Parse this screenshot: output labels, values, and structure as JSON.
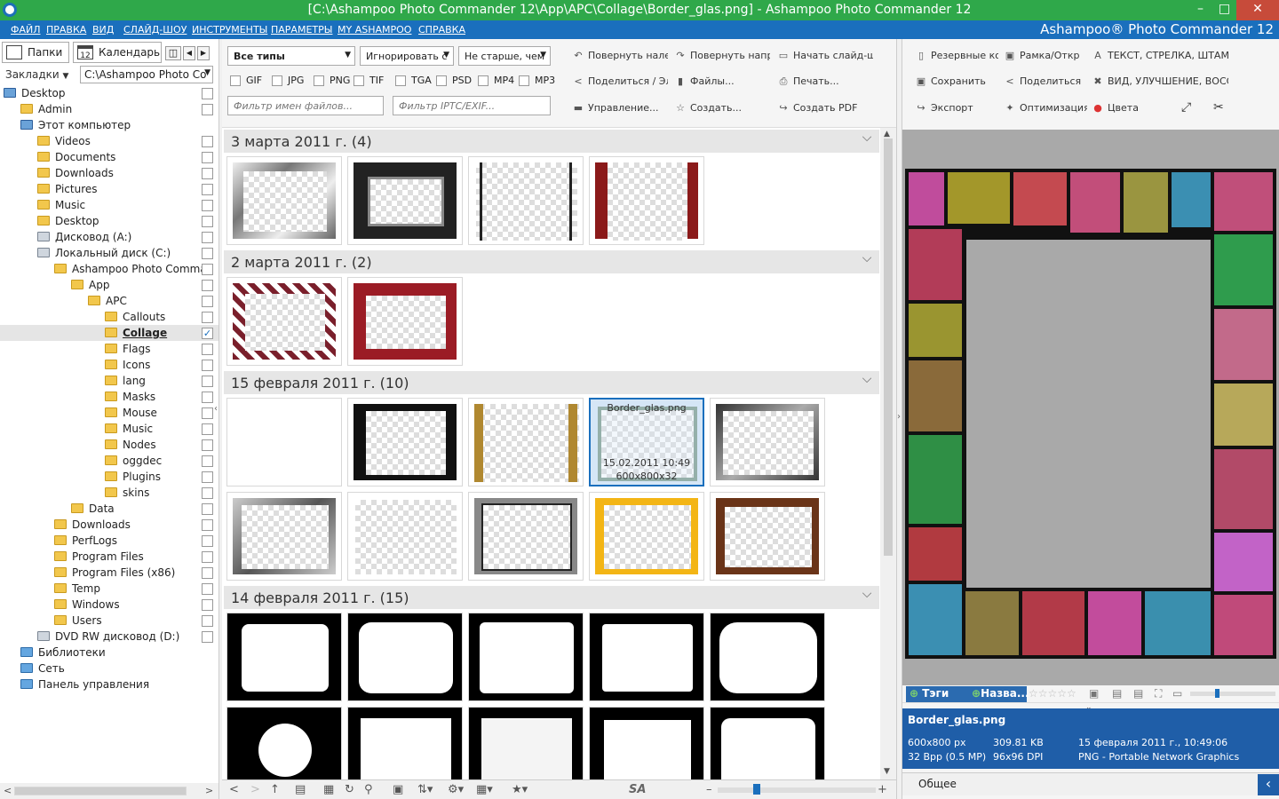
{
  "title": "[C:\\Ashampoo Photo Commander 12\\App\\APC\\Collage\\Border_glas.png] - Ashampoo Photo Commander 12",
  "window_buttons": {
    "minimize": "–",
    "maximize": "□",
    "close": "✕"
  },
  "menu": {
    "items": [
      "ФАЙЛ",
      "ПРАВКА",
      "ВИД",
      "СЛАЙД-ШОУ",
      "ИНСТРУМЕНТЫ",
      "ПАРАМЕТРЫ",
      "MY ASHAMPOO",
      "СПРАВКА"
    ],
    "brand": "Ashampoo® Photo Commander 12"
  },
  "left": {
    "tab_folders": "Папки",
    "tab_calendar": "Календарь",
    "calendar_day": "12",
    "bookmarks": "Закладки",
    "path": "C:\\Ashampoo Photo Co",
    "tree": [
      {
        "label": "Desktop",
        "icon": "pc-icon",
        "level": 0,
        "checked": false
      },
      {
        "label": "Admin",
        "icon": "folder-icon",
        "level": 1,
        "checked": false
      },
      {
        "label": "Этот компьютер",
        "icon": "pc-icon",
        "level": 1,
        "checked": null
      },
      {
        "label": "Videos",
        "icon": "folder-icon",
        "level": 2,
        "checked": false
      },
      {
        "label": "Documents",
        "icon": "folder-icon",
        "level": 2,
        "checked": false
      },
      {
        "label": "Downloads",
        "icon": "folder-icon",
        "level": 2,
        "checked": false
      },
      {
        "label": "Pictures",
        "icon": "folder-icon",
        "level": 2,
        "checked": false
      },
      {
        "label": "Music",
        "icon": "folder-icon",
        "level": 2,
        "checked": false
      },
      {
        "label": "Desktop",
        "icon": "folder-icon",
        "level": 2,
        "checked": false
      },
      {
        "label": "Дисковод (A:)",
        "icon": "drive-icon",
        "level": 2,
        "checked": false
      },
      {
        "label": "Локальный диск (C:)",
        "icon": "drive-icon",
        "level": 2,
        "checked": false
      },
      {
        "label": "Ashampoo Photo Comman",
        "icon": "folder-icon",
        "level": 3,
        "checked": false
      },
      {
        "label": "App",
        "icon": "folder-icon",
        "level": 4,
        "checked": false
      },
      {
        "label": "APC",
        "icon": "folder-icon",
        "level": 5,
        "checked": false
      },
      {
        "label": "Callouts",
        "icon": "folder-icon",
        "level": 6,
        "checked": false
      },
      {
        "label": "Collage",
        "icon": "folder-icon",
        "level": 6,
        "checked": true,
        "selected": true
      },
      {
        "label": "Flags",
        "icon": "folder-icon",
        "level": 6,
        "checked": false
      },
      {
        "label": "Icons",
        "icon": "folder-icon",
        "level": 6,
        "checked": false
      },
      {
        "label": "lang",
        "icon": "folder-icon",
        "level": 6,
        "checked": false
      },
      {
        "label": "Masks",
        "icon": "folder-icon",
        "level": 6,
        "checked": false
      },
      {
        "label": "Mouse",
        "icon": "folder-icon",
        "level": 6,
        "checked": false
      },
      {
        "label": "Music",
        "icon": "folder-icon",
        "level": 6,
        "checked": false
      },
      {
        "label": "Nodes",
        "icon": "folder-icon",
        "level": 6,
        "checked": false
      },
      {
        "label": "oggdec",
        "icon": "folder-icon",
        "level": 6,
        "checked": false
      },
      {
        "label": "Plugins",
        "icon": "folder-icon",
        "level": 6,
        "checked": false
      },
      {
        "label": "skins",
        "icon": "folder-icon",
        "level": 6,
        "checked": false
      },
      {
        "label": "Data",
        "icon": "folder-icon",
        "level": 4,
        "checked": false
      },
      {
        "label": "Downloads",
        "icon": "folder-icon",
        "level": 3,
        "checked": false
      },
      {
        "label": "PerfLogs",
        "icon": "folder-icon",
        "level": 3,
        "checked": false
      },
      {
        "label": "Program Files",
        "icon": "folder-icon",
        "level": 3,
        "checked": false
      },
      {
        "label": "Program Files (x86)",
        "icon": "folder-icon",
        "level": 3,
        "checked": false
      },
      {
        "label": "Temp",
        "icon": "folder-icon",
        "level": 3,
        "checked": false
      },
      {
        "label": "Windows",
        "icon": "folder-icon",
        "level": 3,
        "checked": false
      },
      {
        "label": "Users",
        "icon": "folder-icon",
        "level": 3,
        "checked": false
      },
      {
        "label": "DVD RW дисковод (D:)",
        "icon": "drive-icon",
        "level": 2,
        "checked": false
      },
      {
        "label": "Библиотеки",
        "icon": "network-icon",
        "level": 1,
        "checked": null
      },
      {
        "label": "Сеть",
        "icon": "network-icon",
        "level": 1,
        "checked": null
      },
      {
        "label": "Панель управления",
        "icon": "network-icon",
        "level": 1,
        "checked": null
      }
    ]
  },
  "toolbar": {
    "type_select": "Все типы",
    "ignore_select": "Игнорировать с",
    "age_select": "Не старше, чем",
    "filetypes": [
      "GIF",
      "JPG",
      "PNG",
      "TIF",
      "TGA",
      "PSD",
      "MP4",
      "MP3"
    ],
    "filter_names": "Фильтр имен файлов...",
    "filter_iptc": "Фильтр IPTC/EXIF...",
    "rotate_left": "Повернуть налев",
    "rotate_right": "Повернуть напра",
    "slideshow": "Начать слайд-шо",
    "share": "Поделиться / Эл",
    "files": "Файлы...",
    "print": "Печать...",
    "manage": "Управление...",
    "create": "Создать...",
    "create_pdf": "Создать PDF"
  },
  "groups": [
    {
      "title": "3 марта 2011 г. (4)"
    },
    {
      "title": "2 марта 2011 г. (2)"
    },
    {
      "title": "15 февраля 2011 г. (10)"
    },
    {
      "title": "14 февраля 2011 г. (15)"
    }
  ],
  "selected_thumb": {
    "name": "Border_glas.png",
    "date": "15.02.2011 10:49",
    "dims": "600x800x32"
  },
  "right_toolbar": {
    "backup": "Резервные ко",
    "frame": "Рамка/Откр",
    "text": "ТЕКСТ, СТРЕЛКА, ШТАМП,",
    "save": "Сохранить",
    "share": "Поделиться",
    "view": "ВИД, УЛУЧШЕНИЕ, ВОССТ",
    "export": "Экспорт",
    "optimize": "Оптимизация",
    "colors": "Цвета"
  },
  "tags_bar": {
    "tags": "Тэги",
    "name": "Назва...",
    "rating": 0,
    "stars": "☆☆☆☆☆"
  },
  "info": {
    "filename": "Border_glas.png",
    "size_px": "600x800 px",
    "size_kb": "309.81 KB",
    "datetime": "15 февраля 2011 г., 10:49:06",
    "bpp": "32 Bpp (0.5 MP)",
    "dpi": "96x96 DPI",
    "format": "PNG - Portable Network Graphics"
  },
  "footer": {
    "general": "Общее"
  },
  "colors": {
    "titlebar": "#2fa84a",
    "menubar": "#1a6fbd",
    "selection": "#1a6fbd",
    "info_bg": "#1f5ea8"
  }
}
